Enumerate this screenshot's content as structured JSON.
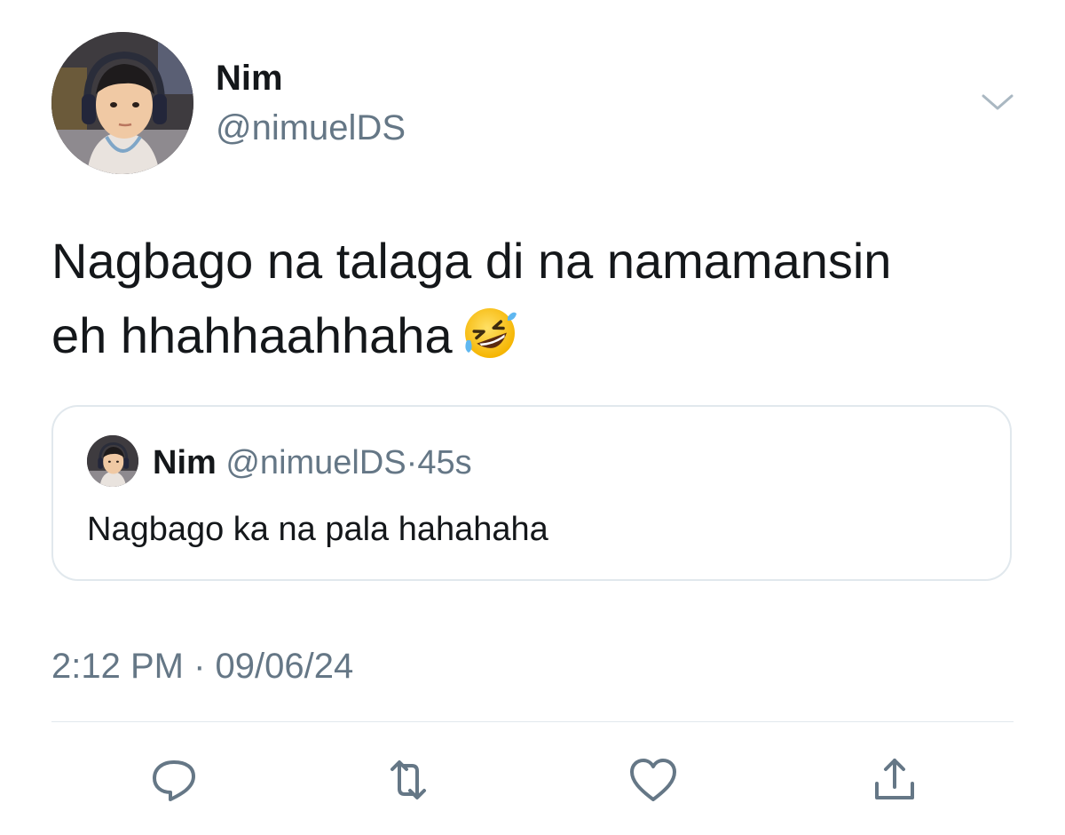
{
  "tweet": {
    "author_name": "Nim",
    "author_handle": "@nimuelDS",
    "text_line1": "Nagbago na talaga di na namamansin",
    "text_line2": "eh hhahhaahhaha",
    "emoji": "rolling-on-the-floor-laughing-emoji",
    "timestamp": "2:12 PM · 09/06/24"
  },
  "quoted_tweet": {
    "author_name": "Nim",
    "author_handle": "@nimuelDS",
    "separator": "·",
    "time_ago": "45s",
    "text": "Nagbago ka na pala hahahaha"
  },
  "actions": [
    {
      "icon": "reply-icon"
    },
    {
      "icon": "retweet-icon"
    },
    {
      "icon": "like-icon"
    },
    {
      "icon": "share-icon"
    }
  ],
  "colors": {
    "primary_text": "#14171a",
    "secondary_text": "#657786",
    "border": "#e1e8ed"
  }
}
